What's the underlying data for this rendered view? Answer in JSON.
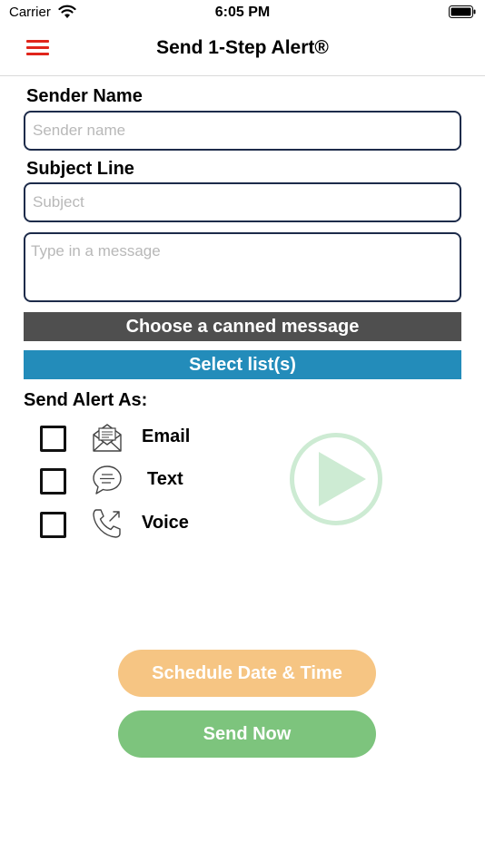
{
  "status": {
    "carrier": "Carrier",
    "time": "6:05 PM"
  },
  "nav": {
    "title": "Send 1-Step Alert®"
  },
  "form": {
    "sender_label": "Sender Name",
    "sender_placeholder": "Sender name",
    "subject_label": "Subject Line",
    "subject_placeholder": "Subject",
    "message_placeholder": "Type in a message"
  },
  "buttons": {
    "canned": "Choose a canned message",
    "select_lists": "Select list(s)",
    "schedule": "Schedule Date & Time",
    "send_now": "Send Now"
  },
  "send_as": {
    "label": "Send Alert As:",
    "options": [
      {
        "label": "Email",
        "icon": "envelope-icon",
        "checked": false
      },
      {
        "label": "Text",
        "icon": "chat-bubble-icon",
        "checked": false
      },
      {
        "label": "Voice",
        "icon": "phone-icon",
        "checked": false
      }
    ]
  },
  "colors": {
    "menu": "#e0251b",
    "canned_bg": "#4f4f4f",
    "lists_bg": "#238cba",
    "schedule_bg": "#f6c583",
    "send_bg": "#7dc47d",
    "play": "#cdebd3"
  }
}
